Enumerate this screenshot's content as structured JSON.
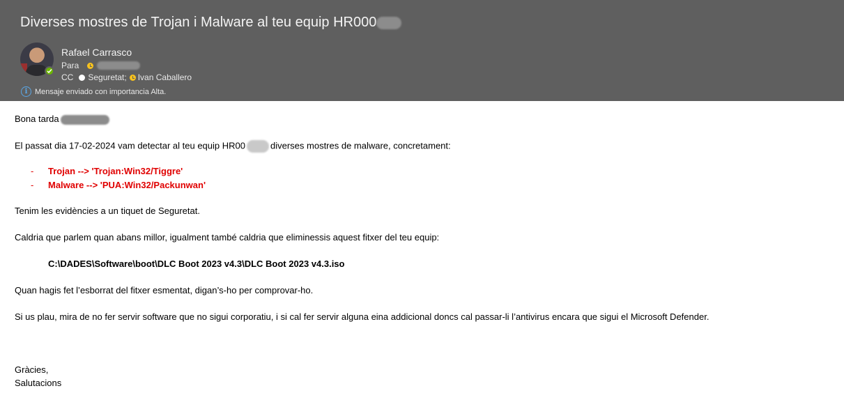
{
  "email": {
    "subject": "Diverses mostres de Trojan i Malware al teu equip HR000",
    "sender_name": "Rafael Carrasco",
    "to_label": "Para",
    "cc_label": "CC",
    "cc_recipients": [
      "Seguretat;",
      "Ivan Caballero"
    ],
    "importance_notice": "Mensaje enviado con importancia Alta."
  },
  "body": {
    "greeting": "Bona tarda",
    "line1": "El passat dia 17-02-2024 vam detectar al teu equip HR00",
    "line1_suffix": "diverses mostres de malware, concretament:",
    "threats": [
      {
        "dash": "-",
        "text": "Trojan --> 'Trojan:Win32/Tiggre'"
      },
      {
        "dash": "-",
        "text": "Malware --> 'PUA:Win32/Packunwan'"
      }
    ],
    "line2": "Tenim les evidències a un tiquet de Seguretat.",
    "line3": "Caldria que parlem quan abans millor, igualment també caldria que eliminessis aquest fitxer del teu equip:",
    "file_path": "C:\\DADES\\Software\\boot\\DLC Boot 2023 v4.3\\DLC Boot 2023 v4.3.iso",
    "line4": "Quan hagis fet l’esborrat del fitxer esmentat, digan’s-ho per comprovar-ho.",
    "line5": "Si us plau, mira de no fer servir software que no sigui corporatiu, i si cal fer servir alguna eina addicional doncs cal passar-li l’antivirus encara que sigui el Microsoft Defender.",
    "closing1": "Gràcies,",
    "closing2": "Salutacions"
  },
  "colors": {
    "header_bg": "#5f5f5f",
    "threat_text": "#e00000",
    "presence_available": "#6bb700",
    "presence_away": "#f8c21d",
    "info_icon": "#5ba7e6"
  }
}
